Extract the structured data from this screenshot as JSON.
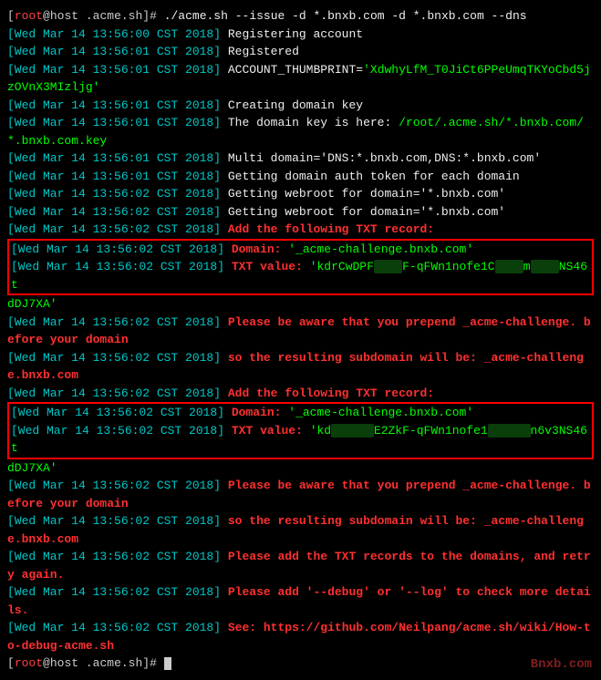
{
  "prompt": {
    "user": "root",
    "host": "host",
    "dir": ".acme.sh",
    "command": "./acme.sh --issue -d *.bnxb.com -d *.bnxb.com --dns"
  },
  "ts": {
    "t0": "[Wed Mar 14 13:56:00 CST 2018]",
    "t1": "[Wed Mar 14 13:56:01 CST 2018]",
    "t2": "[Wed Mar 14 13:56:02 CST 2018]"
  },
  "msg": {
    "reg_account": "Registering account",
    "registered": "Registered",
    "thumb_label": "ACCOUNT_THUMBPRINT=",
    "thumb_val": "'XdwhyLfM_T0JiCt6PPeUmqTKYoCbd5jzOVnX3MIzljg'",
    "creating_key": "Creating domain key",
    "key_here": "The domain key is here: ",
    "key_path": "/root/.acme.sh/*.bnxb.com/*.bnxb.com.key",
    "multi_domain": "Multi domain='DNS:*.bnxb.com,DNS:*.bnxb.com'",
    "auth_token": "Getting domain auth token for each domain",
    "webroot1": "Getting webroot for domain='*.bnxb.com'",
    "webroot2": "Getting webroot for domain='*.bnxb.com'",
    "add_txt": "Add the following TXT record:",
    "domain_label": "Domain: ",
    "domain_val": "'_acme-challenge.bnxb.com'",
    "txt_label": "TXT value: ",
    "txt_val1_a": "'kdrCwDPF",
    "txt_val1_b": "F-qFWn1nofe1C",
    "txt_val1_c": "m",
    "txt_val1_d": "NS46t",
    "txt_tail": "dDJ7XA'",
    "txt_val2_a": "'kd",
    "txt_val2_b": "E2ZkF-qFWn1nofe1",
    "txt_val2_c": "n6v3NS46t",
    "be_aware": "Please be aware that you prepend _acme-challenge. before your domain",
    "resulting": "so the resulting subdomain will be: _acme-challenge.bnxb.com",
    "please_add": "Please add the TXT records to the domains, and retry again.",
    "debug_hint": "Please add '--debug' or '--log' to check more details.",
    "see_label": "See: ",
    "see_url": "https://github.com/Neilpang/acme.sh/wiki/How-to-debug-acme.sh"
  },
  "watermark": "Bnxb.com"
}
